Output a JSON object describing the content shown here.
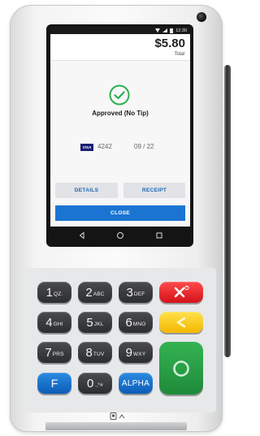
{
  "status_bar": {
    "time": "12:30"
  },
  "transaction": {
    "amount": "$5.80",
    "amount_label": "Total",
    "status_text": "Approved (No Tip)",
    "card_brand": "VISA",
    "card_last4": "4242",
    "card_expiry": "09 / 22"
  },
  "buttons": {
    "details": "DETAILS",
    "receipt": "RECEIPT",
    "close": "CLOSE"
  },
  "keypad": {
    "keys": [
      {
        "num": "1",
        "sub": "QZ."
      },
      {
        "num": "2",
        "sub": "ABC"
      },
      {
        "num": "3",
        "sub": "DEF"
      },
      {
        "num": "4",
        "sub": "GHI"
      },
      {
        "num": "5",
        "sub": "JKL"
      },
      {
        "num": "6",
        "sub": "MNO"
      },
      {
        "num": "7",
        "sub": "PRS"
      },
      {
        "num": "8",
        "sub": "TUV"
      },
      {
        "num": "9",
        "sub": "WXY"
      },
      {
        "num": "0",
        "sub": ".,*#"
      }
    ],
    "f_key": "F",
    "alpha_key": "ALPHA"
  },
  "colors": {
    "accent_blue": "#1b74d2",
    "success_green": "#2bb24c",
    "cancel_red": "#e8232a",
    "clear_yellow": "#f8cf1d",
    "enter_green": "#25a045"
  }
}
